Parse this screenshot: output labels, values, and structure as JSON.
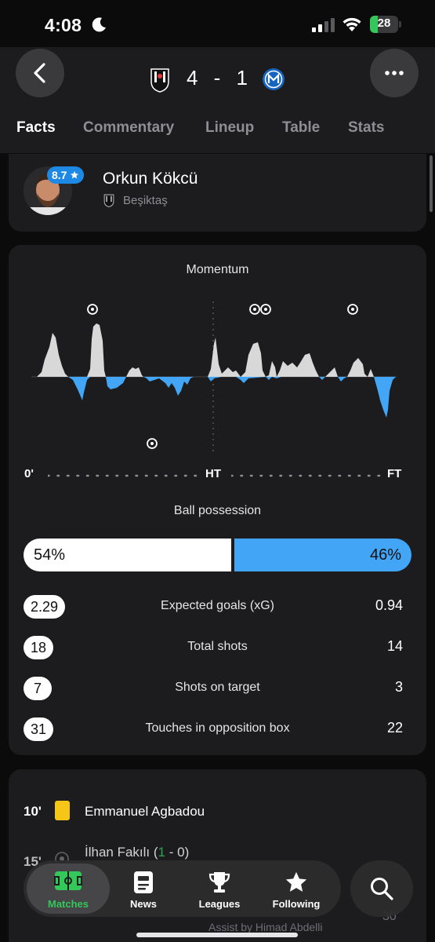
{
  "status_bar": {
    "time": "4:08",
    "battery_percent": "28",
    "battery_level": 0.28
  },
  "header": {
    "home_score": "4",
    "separator": "-",
    "away_score": "1",
    "tabs": [
      {
        "label": "Facts",
        "active": true
      },
      {
        "label": "Commentary",
        "active": false
      },
      {
        "label": "Lineup",
        "active": false
      },
      {
        "label": "Table",
        "active": false
      },
      {
        "label": "Stats",
        "active": false
      }
    ]
  },
  "player_of_match": {
    "rating": "8.7",
    "name": "Orkun Kökcü",
    "team": "Beşiktaş"
  },
  "momentum": {
    "title": "Momentum",
    "axis_start": "0'",
    "axis_mid": "HT",
    "axis_end": "FT"
  },
  "possession": {
    "title": "Ball possession",
    "home": "54%",
    "away": "46%",
    "home_value": 54,
    "away_value": 46
  },
  "stats": [
    {
      "home": "2.29",
      "label": "Expected goals (xG)",
      "away": "0.94"
    },
    {
      "home": "18",
      "label": "Total shots",
      "away": "14"
    },
    {
      "home": "7",
      "label": "Shots on target",
      "away": "3"
    },
    {
      "home": "31",
      "label": "Touches in opposition box",
      "away": "22"
    }
  ],
  "events": [
    {
      "minute": "10'",
      "player": "Emmanuel Agbadou",
      "type": "yellow-card"
    },
    {
      "minute": "15'",
      "player": "İlhan Fakılı",
      "score_home": "1",
      "score_rest": " - 0)",
      "score_open": " (",
      "type": "goal"
    }
  ],
  "footer": {
    "assist": "Assist by Himad Abdelli",
    "minute": "30'"
  },
  "tabbar": {
    "items": [
      {
        "label": "Matches",
        "icon": "pitch-icon",
        "active": true
      },
      {
        "label": "News",
        "icon": "news-icon",
        "active": false
      },
      {
        "label": "Leagues",
        "icon": "trophy-icon",
        "active": false
      },
      {
        "label": "Following",
        "icon": "star-icon",
        "active": false
      }
    ],
    "search_icon": "search-icon"
  },
  "colors": {
    "home_team": "#ffffff",
    "away_team": "#42a5f5",
    "accent_green": "#34c759",
    "rating_blue": "#1e88e5",
    "yellow_card": "#f5c518"
  }
}
